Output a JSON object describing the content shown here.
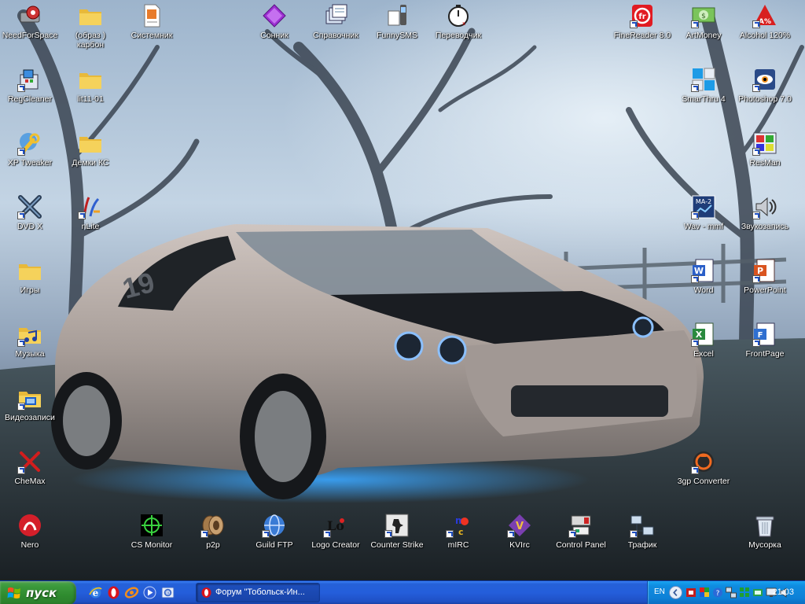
{
  "desktop": {
    "icons": [
      {
        "id": "needforspace",
        "label": "NeedForSpace",
        "icon": "drive-gear-icon",
        "shortcut": false
      },
      {
        "id": "obraz-karbon",
        "label": "(образ )\nкарбон",
        "icon": "folder-icon",
        "shortcut": false
      },
      {
        "id": "sistemnik",
        "label": "Системник",
        "icon": "document-icon",
        "shortcut": false
      },
      {
        "id": "sonnik",
        "label": "Сонник",
        "icon": "purple-diamond-icon",
        "shortcut": false
      },
      {
        "id": "spravochnik",
        "label": "Справочник",
        "icon": "stacked-documents-icon",
        "shortcut": false
      },
      {
        "id": "funnysms",
        "label": "FunnySMS",
        "icon": "mobile-phone-icon",
        "shortcut": false
      },
      {
        "id": "perevodchik",
        "label": "Переводчик",
        "icon": "stopwatch-icon",
        "shortcut": false
      },
      {
        "id": "finereader",
        "label": "FineReader 8.0",
        "icon": "finereader-icon",
        "shortcut": true
      },
      {
        "id": "artmoney",
        "label": "ArtMoney",
        "icon": "money-icon",
        "shortcut": true
      },
      {
        "id": "alcohol",
        "label": "Alcohol 120%",
        "icon": "alcohol-icon",
        "shortcut": true
      },
      {
        "id": "regcleaner",
        "label": "RegCleaner",
        "icon": "registry-icon",
        "shortcut": true
      },
      {
        "id": "lit11",
        "label": "lit11-01",
        "icon": "folder-icon",
        "shortcut": false
      },
      {
        "id": "smarthru",
        "label": "SmarThru 4",
        "icon": "smarthru-icon",
        "shortcut": true
      },
      {
        "id": "photoshop",
        "label": "Photoshop 7.0",
        "icon": "photoshop-eye-icon",
        "shortcut": true
      },
      {
        "id": "xptweaker",
        "label": "XP Tweaker",
        "icon": "wrench-icon",
        "shortcut": true
      },
      {
        "id": "demki",
        "label": "Демки КС",
        "icon": "folder-icon",
        "shortcut": false
      },
      {
        "id": "resman",
        "label": "ResMan",
        "icon": "resman-icon",
        "shortcut": true
      },
      {
        "id": "dvdx",
        "label": "DVD X",
        "icon": "dvd-x-icon",
        "shortcut": true
      },
      {
        "id": "nlite",
        "label": "nLite",
        "icon": "nlite-icon",
        "shortcut": true
      },
      {
        "id": "wav-mmf",
        "label": "Wav - mmf",
        "icon": "ma2-icon",
        "shortcut": true
      },
      {
        "id": "zvukozapis",
        "label": "Звукозапись",
        "icon": "speaker-icon",
        "shortcut": true
      },
      {
        "id": "igry",
        "label": "Игры",
        "icon": "folder-icon",
        "shortcut": false
      },
      {
        "id": "word",
        "label": "Word",
        "icon": "word-icon",
        "shortcut": true
      },
      {
        "id": "powerpoint",
        "label": "PowerPoint",
        "icon": "powerpoint-icon",
        "shortcut": true
      },
      {
        "id": "muzyka",
        "label": "Музыка",
        "icon": "music-folder-icon",
        "shortcut": true
      },
      {
        "id": "excel",
        "label": "Excel",
        "icon": "excel-icon",
        "shortcut": true
      },
      {
        "id": "frontpage",
        "label": "FrontPage",
        "icon": "frontpage-icon",
        "shortcut": true
      },
      {
        "id": "videozapisi",
        "label": "Видеозаписи",
        "icon": "video-folder-icon",
        "shortcut": true
      },
      {
        "id": "chemax",
        "label": "CheMax",
        "icon": "red-x-icon",
        "shortcut": true
      },
      {
        "id": "3gp",
        "label": "3gp Converter",
        "icon": "converter-icon",
        "shortcut": true
      },
      {
        "id": "nero",
        "label": "Nero",
        "icon": "nero-icon",
        "shortcut": false
      },
      {
        "id": "csmonitor",
        "label": "CS Monitor",
        "icon": "crosshair-icon",
        "shortcut": false
      },
      {
        "id": "p2p",
        "label": "p2p",
        "icon": "p2p-icon",
        "shortcut": true
      },
      {
        "id": "guildftp",
        "label": "Guild FTP",
        "icon": "globe-icon",
        "shortcut": true
      },
      {
        "id": "logocreator",
        "label": "Logo Creator",
        "icon": "logo-creator-icon",
        "shortcut": true
      },
      {
        "id": "counterstrike",
        "label": "Counter Strike",
        "icon": "counter-strike-icon",
        "shortcut": true
      },
      {
        "id": "mirc",
        "label": "mIRC",
        "icon": "mirc-icon",
        "shortcut": true
      },
      {
        "id": "kvirc",
        "label": "KVIrc",
        "icon": "kvirc-icon",
        "shortcut": true
      },
      {
        "id": "controlpanel",
        "label": "Control Panel",
        "icon": "control-panel-icon",
        "shortcut": true
      },
      {
        "id": "trafik",
        "label": "Трафик",
        "icon": "network-icon",
        "shortcut": true
      },
      {
        "id": "musorka",
        "label": "Мусорка",
        "icon": "recycle-bin-icon",
        "shortcut": false
      }
    ]
  },
  "taskbar": {
    "start_label": "пуск",
    "quick_launch": [
      "internet-explorer-icon",
      "opera-icon",
      "messenger-icon",
      "media-player-icon",
      "outlook-icon"
    ],
    "task_title": "Форум \"Тобольск-Ин...",
    "task_icon": "opera-icon",
    "tray_lang": "EN",
    "tray_icons": [
      "virus-icon",
      "security-icon",
      "help-icon",
      "network-icon",
      "shield-icon",
      "mixer-icon",
      "monitor-icon",
      "volume-icon"
    ],
    "clock": "21:03"
  },
  "colors": {
    "taskbar_blue": "#245edb",
    "start_green": "#3c9a3c",
    "tray_blue": "#0f8ce0",
    "folder_yellow": "#f5d25b"
  }
}
